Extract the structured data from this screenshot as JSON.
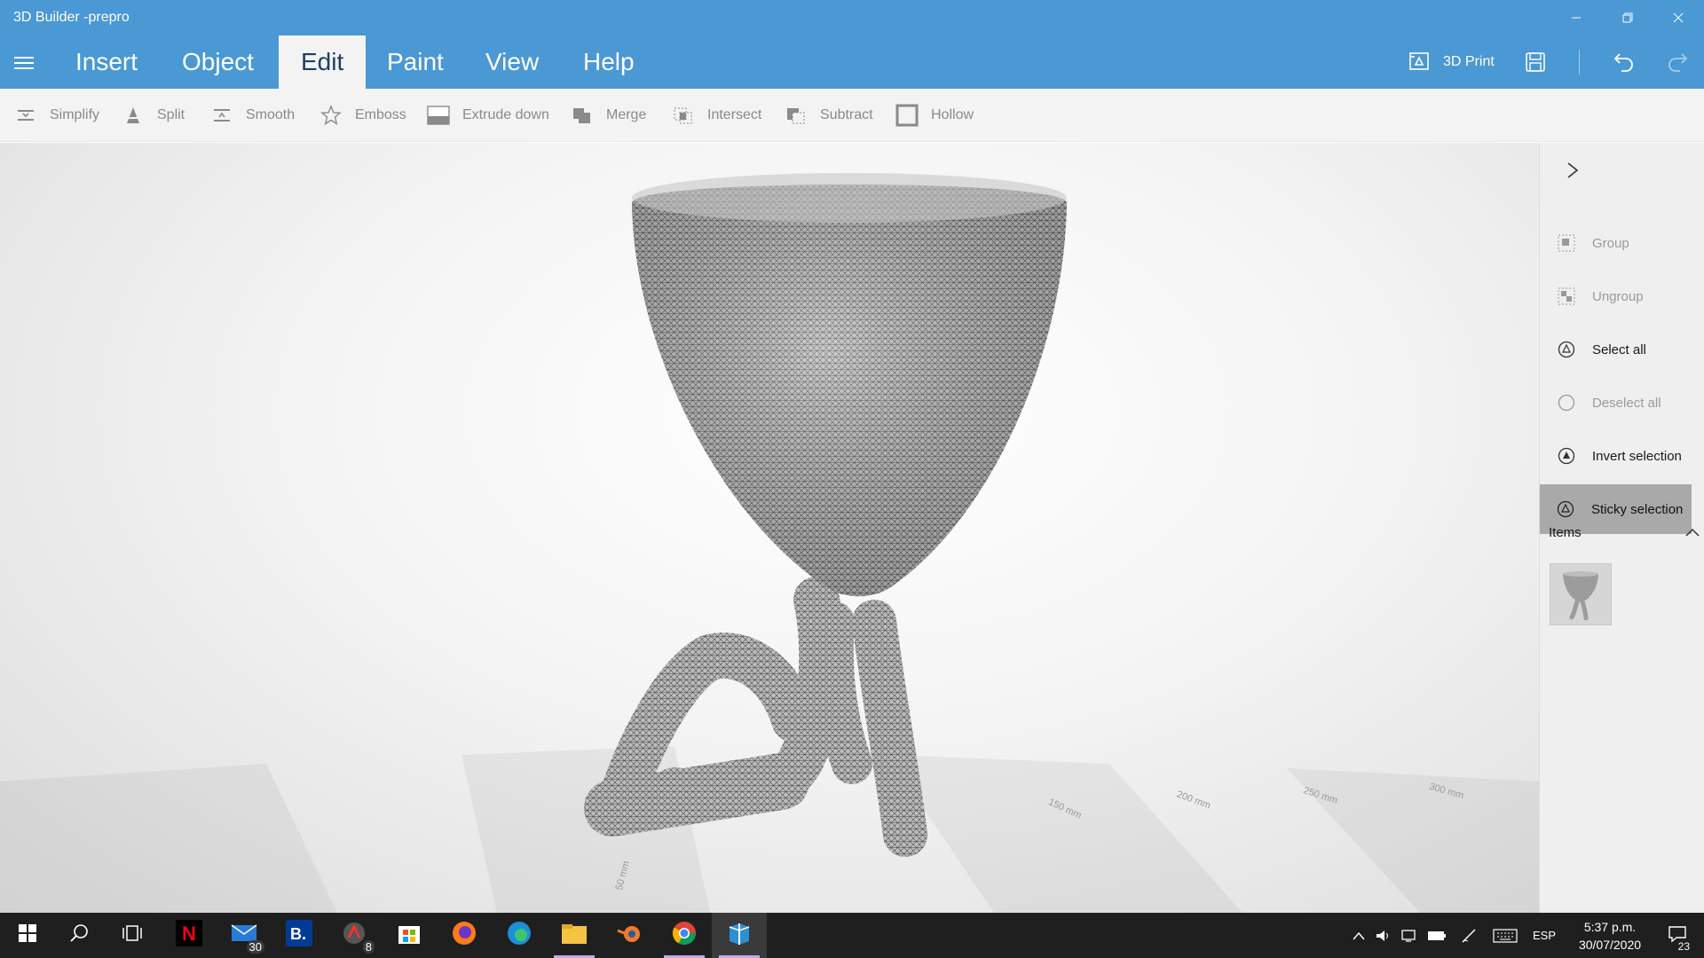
{
  "app": {
    "title": "3D Builder -prepro"
  },
  "menu": {
    "tabs": [
      {
        "label": "Insert",
        "active": false
      },
      {
        "label": "Object",
        "active": false
      },
      {
        "label": "Edit",
        "active": true
      },
      {
        "label": "Paint",
        "active": false
      },
      {
        "label": "View",
        "active": false
      },
      {
        "label": "Help",
        "active": false
      }
    ],
    "print_label": "3D Print"
  },
  "toolbar": {
    "tools": [
      {
        "label": "Simplify",
        "icon": "simplify-icon"
      },
      {
        "label": "Split",
        "icon": "split-icon"
      },
      {
        "label": "Smooth",
        "icon": "smooth-icon"
      },
      {
        "label": "Emboss",
        "icon": "star-icon"
      },
      {
        "label": "Extrude down",
        "icon": "extrude-down-icon"
      },
      {
        "label": "Merge",
        "icon": "merge-icon"
      },
      {
        "label": "Intersect",
        "icon": "intersect-icon"
      },
      {
        "label": "Subtract",
        "icon": "subtract-icon"
      },
      {
        "label": "Hollow",
        "icon": "hollow-icon"
      }
    ]
  },
  "viewport": {
    "rulers": [
      "50 mm",
      "150 mm",
      "200 mm",
      "250 mm",
      "300 mm"
    ]
  },
  "side_panel": {
    "items": [
      {
        "label": "Group",
        "state": "disabled"
      },
      {
        "label": "Ungroup",
        "state": "disabled"
      },
      {
        "label": "Select all",
        "state": "enabled"
      },
      {
        "label": "Deselect all",
        "state": "disabled"
      },
      {
        "label": "Invert selection",
        "state": "enabled"
      },
      {
        "label": "Sticky selection",
        "state": "active"
      }
    ],
    "items_header": "Items"
  },
  "taskbar": {
    "apps": [
      "Netflix",
      "Mail",
      "Booking",
      "App",
      "Microsoft Store",
      "Firefox",
      "Edge",
      "File Explorer",
      "Blender",
      "Chrome",
      "3D Builder"
    ],
    "mail_badge": "30",
    "app_badge": "8",
    "lang": "ESP",
    "time": "5:37 p.m.",
    "date": "30/07/2020",
    "notifications": "23"
  },
  "colors": {
    "titlebar": "#4a98d4",
    "taskbar": "#1f1f1f",
    "active_panel_item": "#a9a9a9"
  }
}
